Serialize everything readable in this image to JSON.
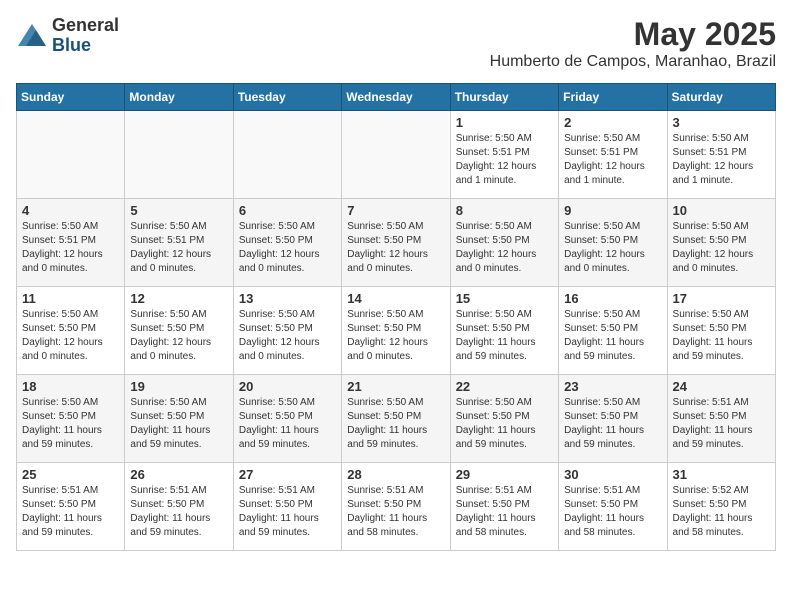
{
  "logo": {
    "general": "General",
    "blue": "Blue"
  },
  "title": "May 2025",
  "location": "Humberto de Campos, Maranhao, Brazil",
  "days_of_week": [
    "Sunday",
    "Monday",
    "Tuesday",
    "Wednesday",
    "Thursday",
    "Friday",
    "Saturday"
  ],
  "weeks": [
    [
      {
        "day": "",
        "info": ""
      },
      {
        "day": "",
        "info": ""
      },
      {
        "day": "",
        "info": ""
      },
      {
        "day": "",
        "info": ""
      },
      {
        "day": "1",
        "info": "Sunrise: 5:50 AM\nSunset: 5:51 PM\nDaylight: 12 hours\nand 1 minute."
      },
      {
        "day": "2",
        "info": "Sunrise: 5:50 AM\nSunset: 5:51 PM\nDaylight: 12 hours\nand 1 minute."
      },
      {
        "day": "3",
        "info": "Sunrise: 5:50 AM\nSunset: 5:51 PM\nDaylight: 12 hours\nand 1 minute."
      }
    ],
    [
      {
        "day": "4",
        "info": "Sunrise: 5:50 AM\nSunset: 5:51 PM\nDaylight: 12 hours\nand 0 minutes."
      },
      {
        "day": "5",
        "info": "Sunrise: 5:50 AM\nSunset: 5:51 PM\nDaylight: 12 hours\nand 0 minutes."
      },
      {
        "day": "6",
        "info": "Sunrise: 5:50 AM\nSunset: 5:50 PM\nDaylight: 12 hours\nand 0 minutes."
      },
      {
        "day": "7",
        "info": "Sunrise: 5:50 AM\nSunset: 5:50 PM\nDaylight: 12 hours\nand 0 minutes."
      },
      {
        "day": "8",
        "info": "Sunrise: 5:50 AM\nSunset: 5:50 PM\nDaylight: 12 hours\nand 0 minutes."
      },
      {
        "day": "9",
        "info": "Sunrise: 5:50 AM\nSunset: 5:50 PM\nDaylight: 12 hours\nand 0 minutes."
      },
      {
        "day": "10",
        "info": "Sunrise: 5:50 AM\nSunset: 5:50 PM\nDaylight: 12 hours\nand 0 minutes."
      }
    ],
    [
      {
        "day": "11",
        "info": "Sunrise: 5:50 AM\nSunset: 5:50 PM\nDaylight: 12 hours\nand 0 minutes."
      },
      {
        "day": "12",
        "info": "Sunrise: 5:50 AM\nSunset: 5:50 PM\nDaylight: 12 hours\nand 0 minutes."
      },
      {
        "day": "13",
        "info": "Sunrise: 5:50 AM\nSunset: 5:50 PM\nDaylight: 12 hours\nand 0 minutes."
      },
      {
        "day": "14",
        "info": "Sunrise: 5:50 AM\nSunset: 5:50 PM\nDaylight: 12 hours\nand 0 minutes."
      },
      {
        "day": "15",
        "info": "Sunrise: 5:50 AM\nSunset: 5:50 PM\nDaylight: 11 hours\nand 59 minutes."
      },
      {
        "day": "16",
        "info": "Sunrise: 5:50 AM\nSunset: 5:50 PM\nDaylight: 11 hours\nand 59 minutes."
      },
      {
        "day": "17",
        "info": "Sunrise: 5:50 AM\nSunset: 5:50 PM\nDaylight: 11 hours\nand 59 minutes."
      }
    ],
    [
      {
        "day": "18",
        "info": "Sunrise: 5:50 AM\nSunset: 5:50 PM\nDaylight: 11 hours\nand 59 minutes."
      },
      {
        "day": "19",
        "info": "Sunrise: 5:50 AM\nSunset: 5:50 PM\nDaylight: 11 hours\nand 59 minutes."
      },
      {
        "day": "20",
        "info": "Sunrise: 5:50 AM\nSunset: 5:50 PM\nDaylight: 11 hours\nand 59 minutes."
      },
      {
        "day": "21",
        "info": "Sunrise: 5:50 AM\nSunset: 5:50 PM\nDaylight: 11 hours\nand 59 minutes."
      },
      {
        "day": "22",
        "info": "Sunrise: 5:50 AM\nSunset: 5:50 PM\nDaylight: 11 hours\nand 59 minutes."
      },
      {
        "day": "23",
        "info": "Sunrise: 5:50 AM\nSunset: 5:50 PM\nDaylight: 11 hours\nand 59 minutes."
      },
      {
        "day": "24",
        "info": "Sunrise: 5:51 AM\nSunset: 5:50 PM\nDaylight: 11 hours\nand 59 minutes."
      }
    ],
    [
      {
        "day": "25",
        "info": "Sunrise: 5:51 AM\nSunset: 5:50 PM\nDaylight: 11 hours\nand 59 minutes."
      },
      {
        "day": "26",
        "info": "Sunrise: 5:51 AM\nSunset: 5:50 PM\nDaylight: 11 hours\nand 59 minutes."
      },
      {
        "day": "27",
        "info": "Sunrise: 5:51 AM\nSunset: 5:50 PM\nDaylight: 11 hours\nand 59 minutes."
      },
      {
        "day": "28",
        "info": "Sunrise: 5:51 AM\nSunset: 5:50 PM\nDaylight: 11 hours\nand 58 minutes."
      },
      {
        "day": "29",
        "info": "Sunrise: 5:51 AM\nSunset: 5:50 PM\nDaylight: 11 hours\nand 58 minutes."
      },
      {
        "day": "30",
        "info": "Sunrise: 5:51 AM\nSunset: 5:50 PM\nDaylight: 11 hours\nand 58 minutes."
      },
      {
        "day": "31",
        "info": "Sunrise: 5:52 AM\nSunset: 5:50 PM\nDaylight: 11 hours\nand 58 minutes."
      }
    ]
  ]
}
